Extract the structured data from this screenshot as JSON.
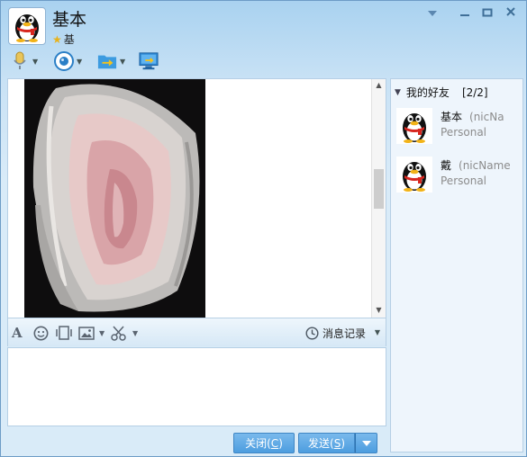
{
  "header": {
    "contact_name": "基本",
    "contact_sub": "基",
    "window_controls": [
      "chevron-down-icon",
      "minimize-icon",
      "maximize-icon",
      "close-icon"
    ]
  },
  "top_toolbar": {
    "items": [
      "microphone-icon",
      "camera-icon",
      "send-file-icon",
      "screen-share-icon"
    ]
  },
  "chat": {
    "image_description_icon": "shared-photo"
  },
  "format_toolbar": {
    "items": [
      "font-icon",
      "emoji-icon",
      "vibrate-icon",
      "image-icon",
      "scissors-icon"
    ],
    "history_label": "消息记录"
  },
  "input": {
    "value": "",
    "placeholder": ""
  },
  "buttons": {
    "close_label": "关闭(",
    "close_key": "C",
    "send_label": "发送(",
    "send_key": "S",
    "paren_close": ")"
  },
  "friends_panel": {
    "group_name": "我的好友",
    "group_count": "[2/2]",
    "friends": [
      {
        "name": "基本",
        "nick": "(nicNa",
        "status": "Personal"
      },
      {
        "name": "戴",
        "nick": "(nicName",
        "status": "Personal"
      }
    ]
  },
  "colors": {
    "accent": "#4d9ddf",
    "title_bg": "#a9d2f0",
    "panel_bg": "#eef5fc"
  }
}
